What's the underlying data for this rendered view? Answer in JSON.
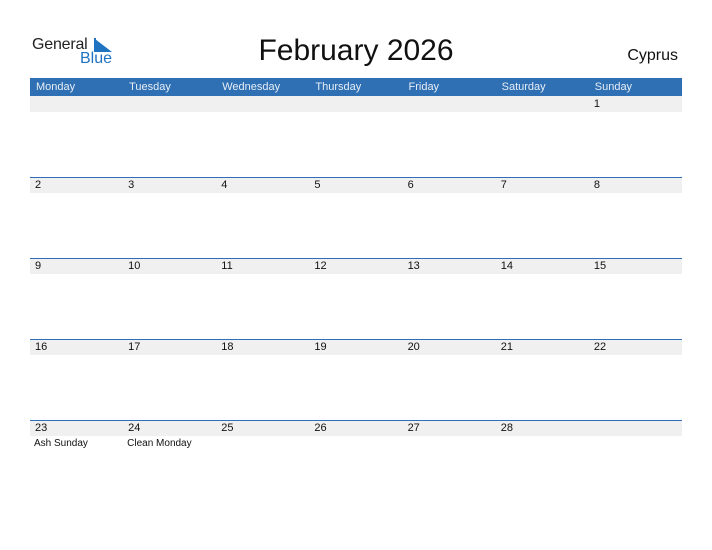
{
  "logo": {
    "general": "General",
    "blue": "Blue"
  },
  "title": "February 2026",
  "country": "Cyprus",
  "colors": {
    "header": "#2e70b3",
    "band": "#f0f0f0",
    "brand_blue": "#1f73c1"
  },
  "weekdays": [
    "Monday",
    "Tuesday",
    "Wednesday",
    "Thursday",
    "Friday",
    "Saturday",
    "Sunday"
  ],
  "weeks": [
    [
      {
        "d": ""
      },
      {
        "d": ""
      },
      {
        "d": ""
      },
      {
        "d": ""
      },
      {
        "d": ""
      },
      {
        "d": ""
      },
      {
        "d": "1"
      }
    ],
    [
      {
        "d": "2"
      },
      {
        "d": "3"
      },
      {
        "d": "4"
      },
      {
        "d": "5"
      },
      {
        "d": "6"
      },
      {
        "d": "7"
      },
      {
        "d": "8"
      }
    ],
    [
      {
        "d": "9"
      },
      {
        "d": "10"
      },
      {
        "d": "11"
      },
      {
        "d": "12"
      },
      {
        "d": "13"
      },
      {
        "d": "14"
      },
      {
        "d": "15"
      }
    ],
    [
      {
        "d": "16"
      },
      {
        "d": "17"
      },
      {
        "d": "18"
      },
      {
        "d": "19"
      },
      {
        "d": "20"
      },
      {
        "d": "21"
      },
      {
        "d": "22"
      }
    ],
    [
      {
        "d": "23",
        "h": "Ash Sunday"
      },
      {
        "d": "24",
        "h": "Clean Monday"
      },
      {
        "d": "25"
      },
      {
        "d": "26"
      },
      {
        "d": "27"
      },
      {
        "d": "28"
      },
      {
        "d": ""
      }
    ]
  ]
}
